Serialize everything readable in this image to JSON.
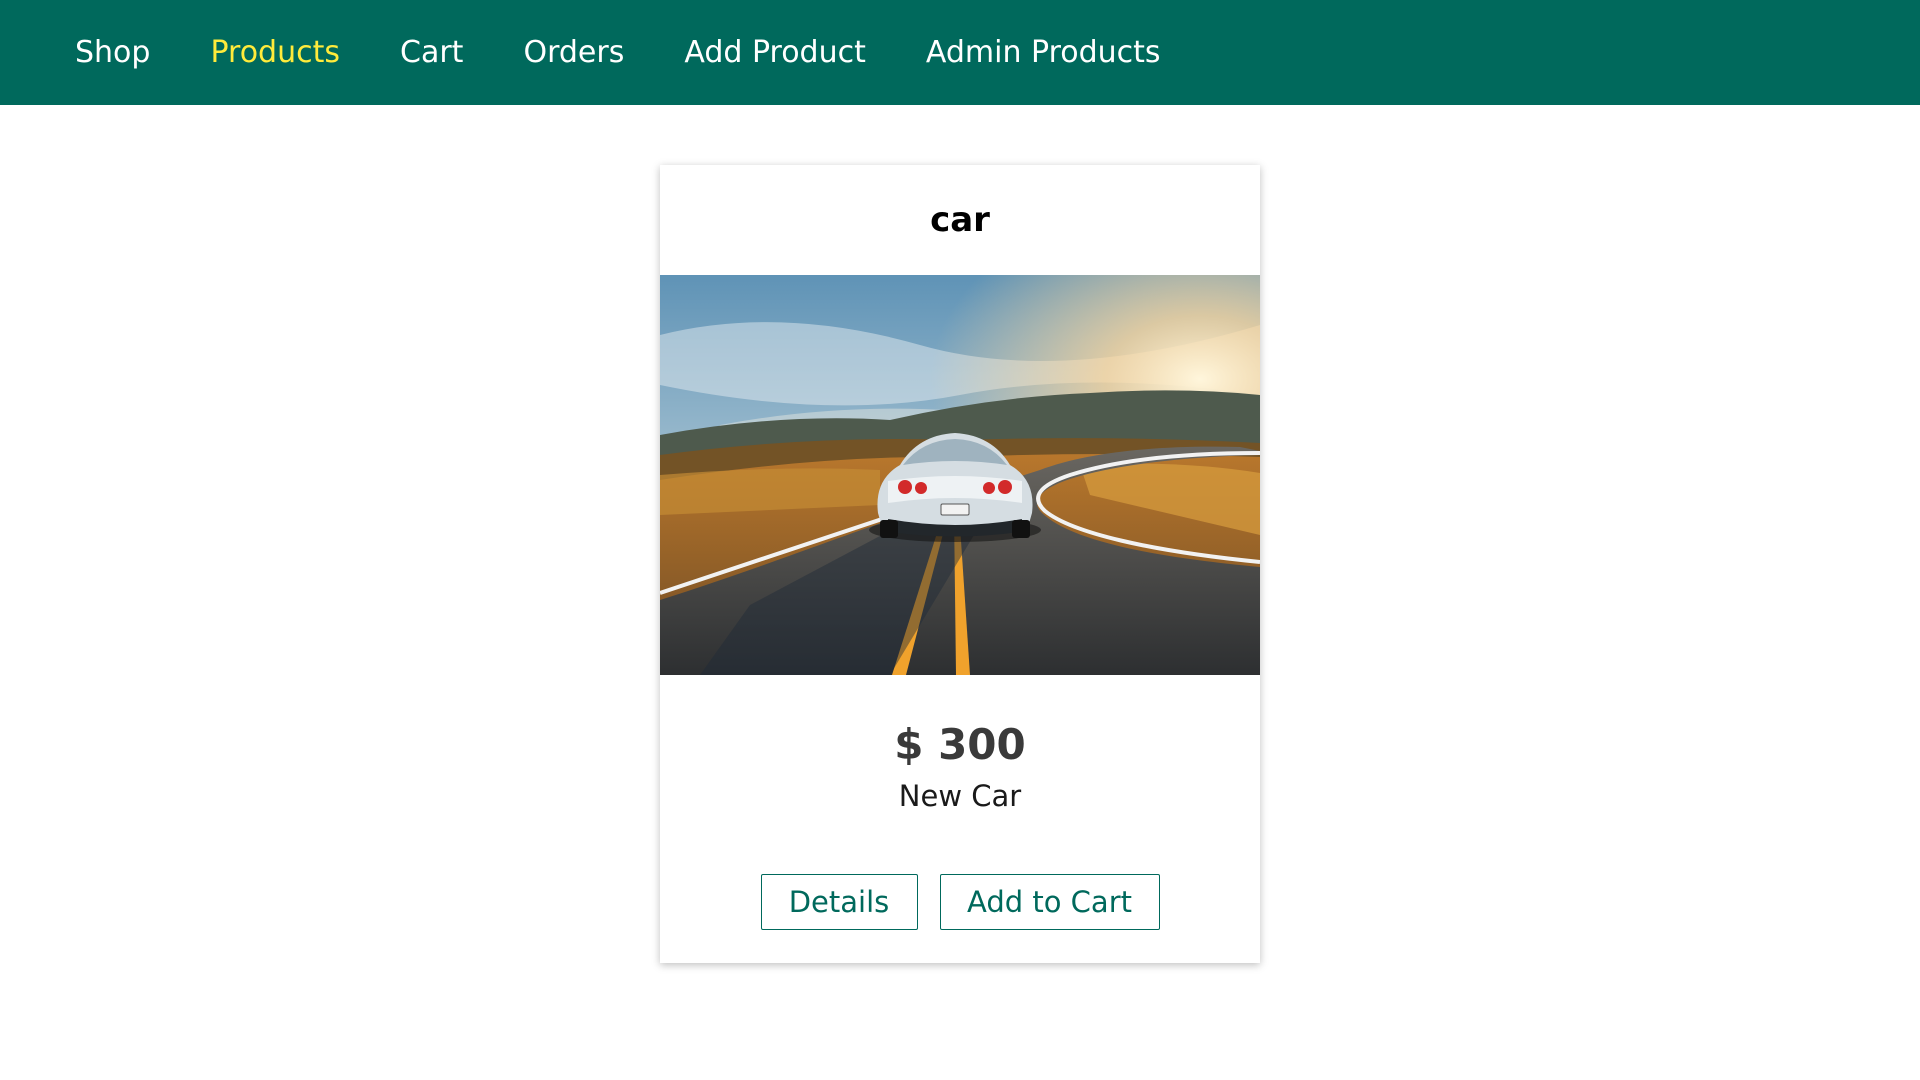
{
  "nav": {
    "items": [
      {
        "label": "Shop",
        "active": false
      },
      {
        "label": "Products",
        "active": true
      },
      {
        "label": "Cart",
        "active": false
      },
      {
        "label": "Orders",
        "active": false
      },
      {
        "label": "Add Product",
        "active": false
      },
      {
        "label": "Admin Products",
        "active": false
      }
    ]
  },
  "product": {
    "title": "car",
    "image_subject": "white sports car on a winding mountain road at sunset",
    "price": "$ 300",
    "description": "New Car",
    "details_label": "Details",
    "add_to_cart_label": "Add to Cart"
  },
  "colors": {
    "header_bg": "#00695c",
    "nav_text": "#ffffff",
    "nav_active": "#ffeb3b",
    "button_accent": "#00695c"
  }
}
